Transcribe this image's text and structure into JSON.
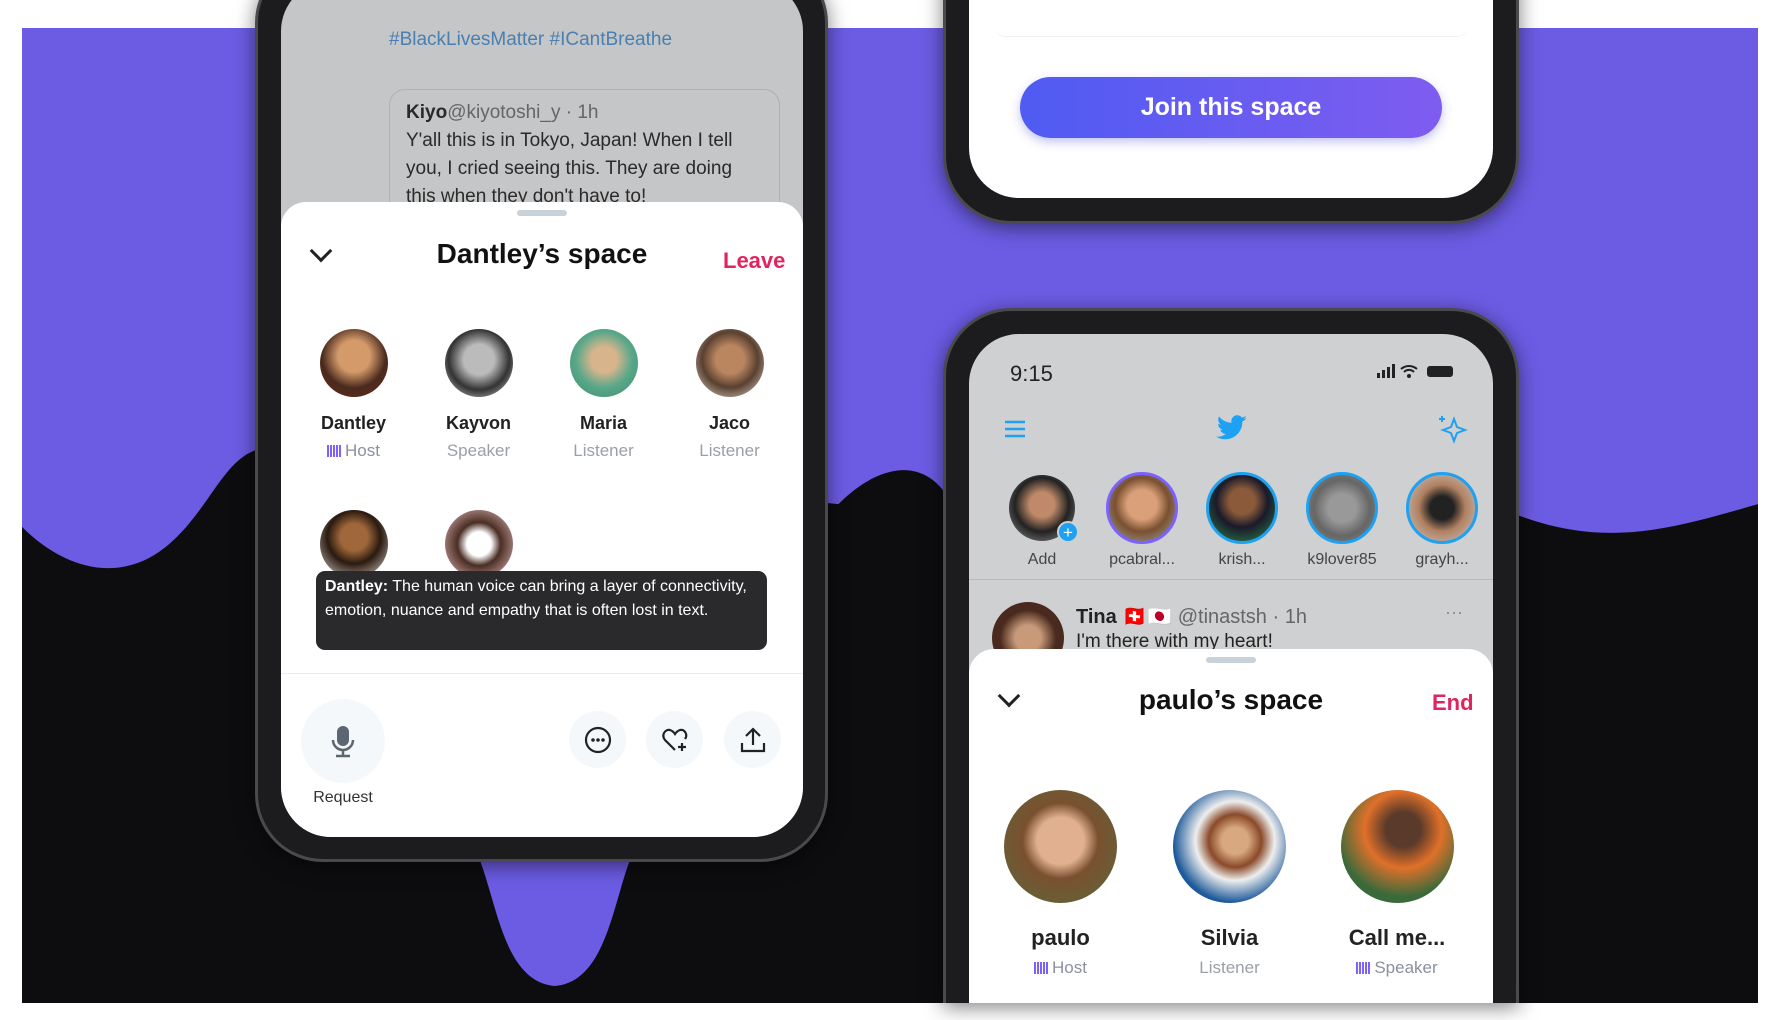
{
  "colors": {
    "background": "#6c5ce4",
    "accent_red": "#e0245e",
    "twitter_blue": "#1da1f2",
    "host_purple": "#7b61ff"
  },
  "left_phone": {
    "background_tweet": {
      "hashtags": "#BlackLivesMatter #ICantBreathe",
      "quote_author": "Kiyo",
      "quote_handle": "@kiyotoshi_y · 1h",
      "quote_text": "Y'all this is in Tokyo, Japan! When I tell you, I cried seeing this. They are doing this when they don't have to!"
    },
    "space": {
      "title": "Dantley’s space",
      "leave_label": "Leave",
      "participants": [
        {
          "name": "Dantley",
          "role": "Host",
          "icon": "audio-wave-icon"
        },
        {
          "name": "Kayvon",
          "role": "Speaker"
        },
        {
          "name": "Maria",
          "role": "Listener"
        },
        {
          "name": "Jaco",
          "role": "Listener"
        }
      ],
      "caption": {
        "speaker": "Dantley:",
        "text": " The human voice can bring a layer of connectivity, emotion, nuance and empathy that is often lost in text."
      },
      "request_label": "Request",
      "actions": [
        "more-icon",
        "heart-plus-icon",
        "share-icon"
      ]
    }
  },
  "top_right_phone": {
    "join_label": "Join this space"
  },
  "bottom_right_phone": {
    "status": {
      "time": "9:15"
    },
    "fleets": [
      {
        "label": "Add"
      },
      {
        "label": "pcabral..."
      },
      {
        "label": "krish..."
      },
      {
        "label": "k9lover85"
      },
      {
        "label": "grayh..."
      }
    ],
    "tweet": {
      "author": "Tina",
      "flags": "🇨🇭🇯🇵",
      "handle": "@tinastsh · 1h",
      "text": "I'm there with my heart!",
      "more": "···"
    },
    "space": {
      "title": "paulo’s space",
      "end_label": "End",
      "participants": [
        {
          "name": "paulo",
          "role": "Host",
          "icon": "audio-wave-icon"
        },
        {
          "name": "Silvia",
          "role": "Listener"
        },
        {
          "name": "Call me...",
          "role": "Speaker",
          "icon": "audio-wave-icon"
        }
      ]
    }
  }
}
